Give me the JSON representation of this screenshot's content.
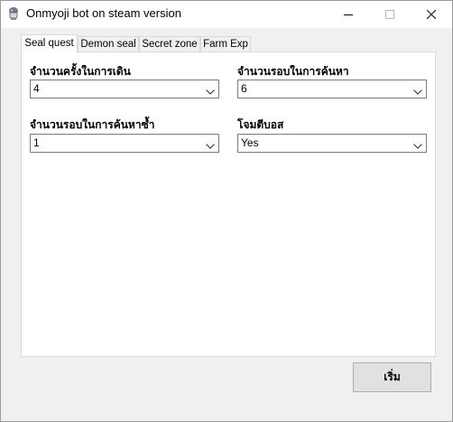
{
  "window": {
    "title": "Onmyoji bot on steam version",
    "icon": "python-icon"
  },
  "tabs": [
    {
      "label": "Seal quest",
      "active": true
    },
    {
      "label": "Demon seal",
      "active": false
    },
    {
      "label": "Secret zone",
      "active": false
    },
    {
      "label": "Farm Exp",
      "active": false
    }
  ],
  "fields": {
    "walk_count": {
      "label": "จำนวนครั้งในการเดิน",
      "value": "4"
    },
    "search_rounds": {
      "label": "จำนวนรอบในการค้นหา",
      "value": "6"
    },
    "repeat_search_rounds": {
      "label": "จำนวนรอบในการค้นหาซ้ำ",
      "value": "1"
    },
    "attack_boss": {
      "label": "โจมตีบอส",
      "value": "Yes"
    }
  },
  "start_button": {
    "label": "เริ่ม"
  }
}
